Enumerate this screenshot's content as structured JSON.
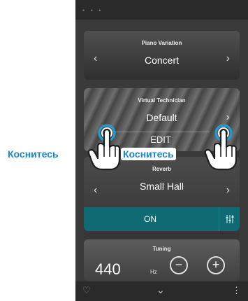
{
  "piano_variation": {
    "title": "Piano Variation",
    "value": "Concert",
    "prev": "‹",
    "next": "›"
  },
  "virtual_technician": {
    "title": "Virtual Technician",
    "value": "Default",
    "next": "›",
    "edit": "EDIT"
  },
  "reverb": {
    "title": "Reverb",
    "value": "Small Hall",
    "prev": "‹",
    "next": "›",
    "on_label": "ON"
  },
  "tuning": {
    "title": "Tuning",
    "value": "440",
    "unit": "Hz",
    "minus": "−",
    "plus": "+"
  },
  "hints": {
    "left": "Коснитесь",
    "right": "Коснитесь"
  },
  "bottombar": {
    "heart": "♡",
    "chevron": "⌄",
    "menu": "⋮"
  },
  "colors": {
    "accent": "#0f6a73",
    "hint": "#1c86c8",
    "touch_ring": "#1c9fd8"
  },
  "icons": [
    "heart-icon",
    "chevron-down-icon",
    "menu-dots-icon",
    "equalizer-icon",
    "touch-hand-icon"
  ]
}
